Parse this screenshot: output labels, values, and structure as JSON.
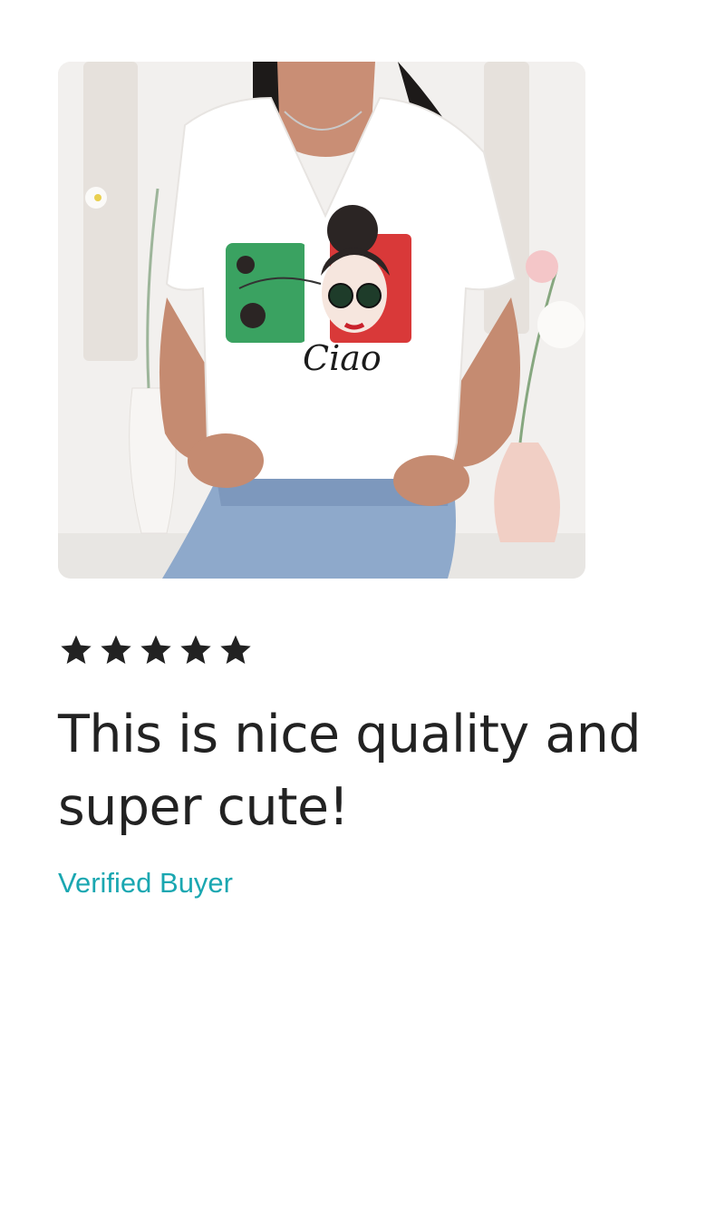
{
  "review": {
    "photo_icon": "product-photo-tshirt",
    "photo_caption_text": "Ciao",
    "rating": 5,
    "rating_max": 5,
    "star_color": "#222222",
    "text": "This is nice quality and super cute!",
    "buyer_label": "Verified Buyer",
    "buyer_label_color": "#1aa7b1"
  }
}
